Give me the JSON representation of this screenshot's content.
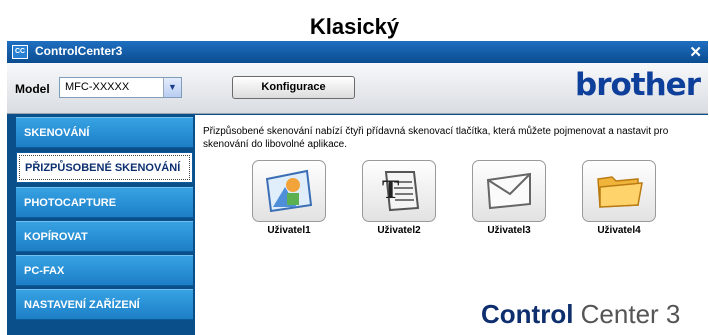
{
  "caption": "Klasický",
  "window": {
    "title": "ControlCenter3",
    "app_icon_text": "CC"
  },
  "toolbar": {
    "model_label": "Model",
    "model_value": "MFC-XXXXX",
    "configure_label": "Konfigurace",
    "brand": "brother"
  },
  "sidebar": {
    "items": [
      {
        "label": "SKENOVÁNÍ"
      },
      {
        "label": "PŘIZPŮSOBENÉ SKENOVÁNÍ",
        "active": true
      },
      {
        "label": "PHOTOCAPTURE"
      },
      {
        "label": "KOPÍROVAT"
      },
      {
        "label": "PC-FAX"
      },
      {
        "label": "NASTAVENÍ ZAŘÍZENÍ"
      }
    ]
  },
  "main": {
    "description": "Přizpůsobené skenování nabízí čtyři přídavná skenovací tlačítka, která můžete pojmenovat a nastavit pro skenování do libovolné aplikace.",
    "buttons": [
      {
        "label": "Uživatel1",
        "icon": "image-icon"
      },
      {
        "label": "Uživatel2",
        "icon": "text-document-icon"
      },
      {
        "label": "Uživatel3",
        "icon": "envelope-icon"
      },
      {
        "label": "Uživatel4",
        "icon": "folder-icon"
      }
    ],
    "logo_bold": "Control",
    "logo_light": " Center 3"
  }
}
